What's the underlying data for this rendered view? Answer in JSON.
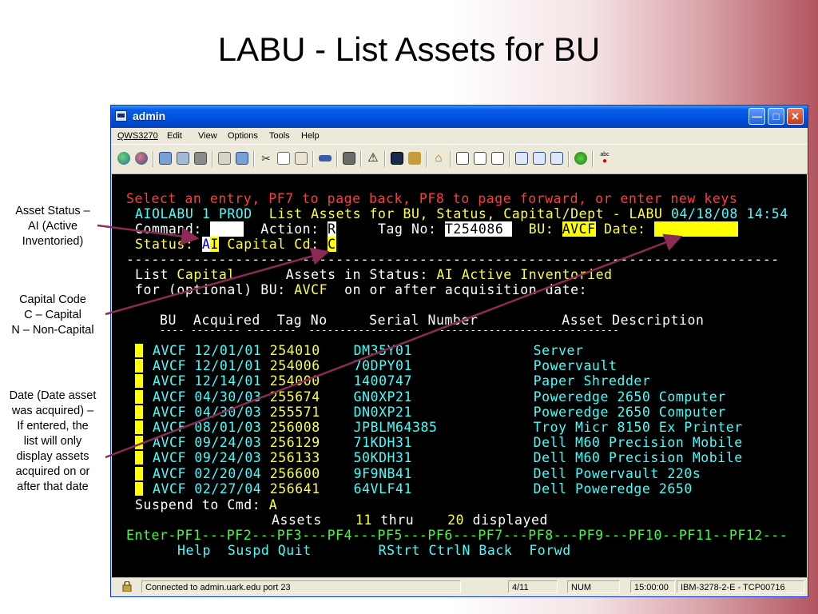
{
  "slide": {
    "title": "LABU - List Assets for BU",
    "notes": {
      "asset_status": [
        "Asset Status –",
        "AI (Active",
        "Inventoried)"
      ],
      "capital_code": [
        "Capital Code",
        "C – Capital",
        "N – Non-Capital"
      ],
      "date": [
        "Date (Date asset",
        "was acquired) –",
        "If entered, the",
        "list will only",
        "display assets",
        "acquired on or",
        "after that date"
      ]
    }
  },
  "window": {
    "title": "admin",
    "menu": [
      "QWS3270",
      "Edit",
      "View",
      "Options",
      "Tools",
      "Help"
    ]
  },
  "terminal": {
    "message": "Select an entry, PF7 to page back, PF8 to page forward, or enter new keys",
    "header_left": "AIOLABU 1 PROD",
    "header_title": "List Assets for BU, Status, Capital/Dept - LABU",
    "header_datetime": "04/18/08 14:54",
    "command_label": "Command:",
    "command_value": "    ",
    "action_label": "Action:",
    "action_value": "R",
    "tagno_label": "Tag No:",
    "tagno_value": "T254086 ",
    "bu_label": "BU:",
    "bu_value": "AVCF",
    "date_label": "Date:",
    "date_value": "          ",
    "status_label": "Status:",
    "status_value_1": "A",
    "status_value_2": "I",
    "capcd_label": "Capital Cd:",
    "capcd_value": "C",
    "divider": "------------------------------------------------------------------------------",
    "list_label": "List",
    "list_type": "Capital",
    "assets_in_status": "Assets in Status:",
    "status_desc": "AI Active Inventoried",
    "for_label": "for (optional) BU:",
    "for_bu": "AVCF",
    "on_after": "on or after acquisition date:",
    "col_headers": "BU  Acquired  Tag No     Serial Number          Asset Description",
    "col_dashes": "---- -------- --------  ------------------  ------------------------------",
    "rows": [
      {
        "bu": "AVCF",
        "acquired": "12/01/01",
        "tag": "254010",
        "serial": "DM35Y01",
        "desc": "Server"
      },
      {
        "bu": "AVCF",
        "acquired": "12/01/01",
        "tag": "254006",
        "serial": "70DPY01",
        "desc": "Powervault"
      },
      {
        "bu": "AVCF",
        "acquired": "12/14/01",
        "tag": "254000",
        "serial": "1400747",
        "desc": "Paper Shredder"
      },
      {
        "bu": "AVCF",
        "acquired": "04/30/03",
        "tag": "255674",
        "serial": "GN0XP21",
        "desc": "Poweredge 2650 Computer"
      },
      {
        "bu": "AVCF",
        "acquired": "04/30/03",
        "tag": "255571",
        "serial": "DN0XP21",
        "desc": "Poweredge 2650 Computer"
      },
      {
        "bu": "AVCF",
        "acquired": "08/01/03",
        "tag": "256008",
        "serial": "JPBLM64385",
        "desc": "Troy Micr 8150 Ex Printer"
      },
      {
        "bu": "AVCF",
        "acquired": "09/24/03",
        "tag": "256129",
        "serial": "71KDH31",
        "desc": "Dell M60 Precision Mobile"
      },
      {
        "bu": "AVCF",
        "acquired": "09/24/03",
        "tag": "256133",
        "serial": "50KDH31",
        "desc": "Dell M60 Precision Mobile"
      },
      {
        "bu": "AVCF",
        "acquired": "02/20/04",
        "tag": "256600",
        "serial": "9F9NB41",
        "desc": "Dell Powervault 220s"
      },
      {
        "bu": "AVCF",
        "acquired": "02/27/04",
        "tag": "256641",
        "serial": "64VLF41",
        "desc": "Dell Poweredge 2650"
      }
    ],
    "suspend_label": "Suspend to Cmd:",
    "suspend_value": "A",
    "assets_label": "Assets",
    "from_n": "11",
    "thru_label": "thru",
    "to_n": "20",
    "displayed_label": "displayed",
    "pf_keys": "Enter-PF1---PF2---PF3---PF4---PF5---PF6---PF7---PF8---PF9---PF10--PF11--PF12---",
    "pf_labels": "Help  Suspd Quit        RStrt CtrlN Back  Forwd"
  },
  "statusbar": {
    "connection": "Connected to admin.uark.edu port 23",
    "position": "4/11",
    "num": "NUM",
    "time": "15:00:00",
    "terminal_type": "IBM-3278-2-E - TCP00716"
  },
  "colors": {
    "terminal_bg": "#000000",
    "red": "#ff3b3b",
    "cyan": "#40ffff",
    "yellow": "#ffff3a",
    "green": "#3aff3a",
    "arrow": "#8b2a55"
  }
}
